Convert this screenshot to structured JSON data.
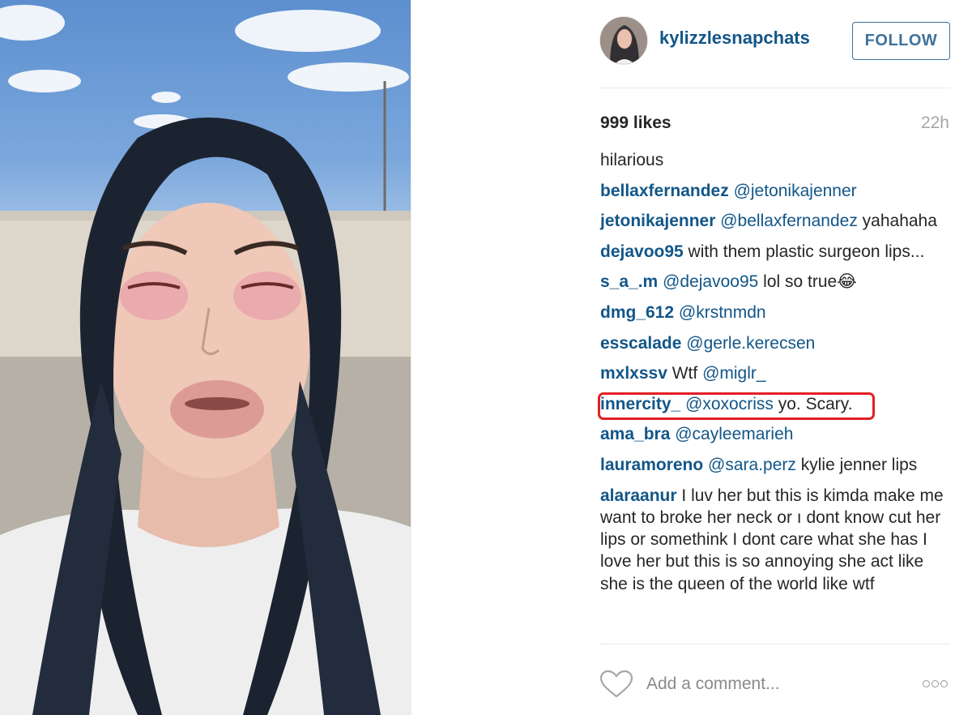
{
  "post": {
    "username": "kylizzlesnapchats",
    "follow_label": "FOLLOW",
    "likes": "999 likes",
    "time_ago": "22h",
    "caption": "hilarious"
  },
  "comments": [
    {
      "user": "bellaxfernandez",
      "mention": "@jetonikajenner",
      "text": ""
    },
    {
      "user": "jetonikajenner",
      "mention": "@bellaxfernandez",
      "text": " yahahaha"
    },
    {
      "user": "dejavoo95",
      "mention": "",
      "text": " with them plastic surgeon lips..."
    },
    {
      "user": "s_a_.m",
      "mention": "@dejavoo95",
      "text": " lol so true😂"
    },
    {
      "user": "dmg_612",
      "mention": "@krstnmdn",
      "text": ""
    },
    {
      "user": "esscalade",
      "mention": "@gerle.kerecsen",
      "text": ""
    },
    {
      "user": "mxlxssv",
      "mention": "",
      "text": " Wtf ",
      "mention2": "@miglr_"
    },
    {
      "user": "innercity_",
      "mention": "@xoxocriss",
      "text": " yo. Scary."
    },
    {
      "user": "ama_bra",
      "mention": "@cayleemarieh",
      "text": ""
    },
    {
      "user": "lauramoreno",
      "mention": "@sara.perz",
      "text": " kylie jenner lips"
    },
    {
      "user": "alaraanur",
      "mention": "",
      "text": " I luv her but this is kimda make me want to broke her neck or ı dont know cut her lips or somethink I dont care what she has I love her but this is so annoying she act like she is the queen of the world like wtf"
    }
  ],
  "footer": {
    "comment_placeholder": "Add a comment..."
  },
  "colors": {
    "link_blue": "#125688",
    "follow_blue": "#3f729b",
    "highlight_red": "#e21f26"
  },
  "icons": {
    "like": "heart-icon",
    "more": "more-options-icon"
  }
}
